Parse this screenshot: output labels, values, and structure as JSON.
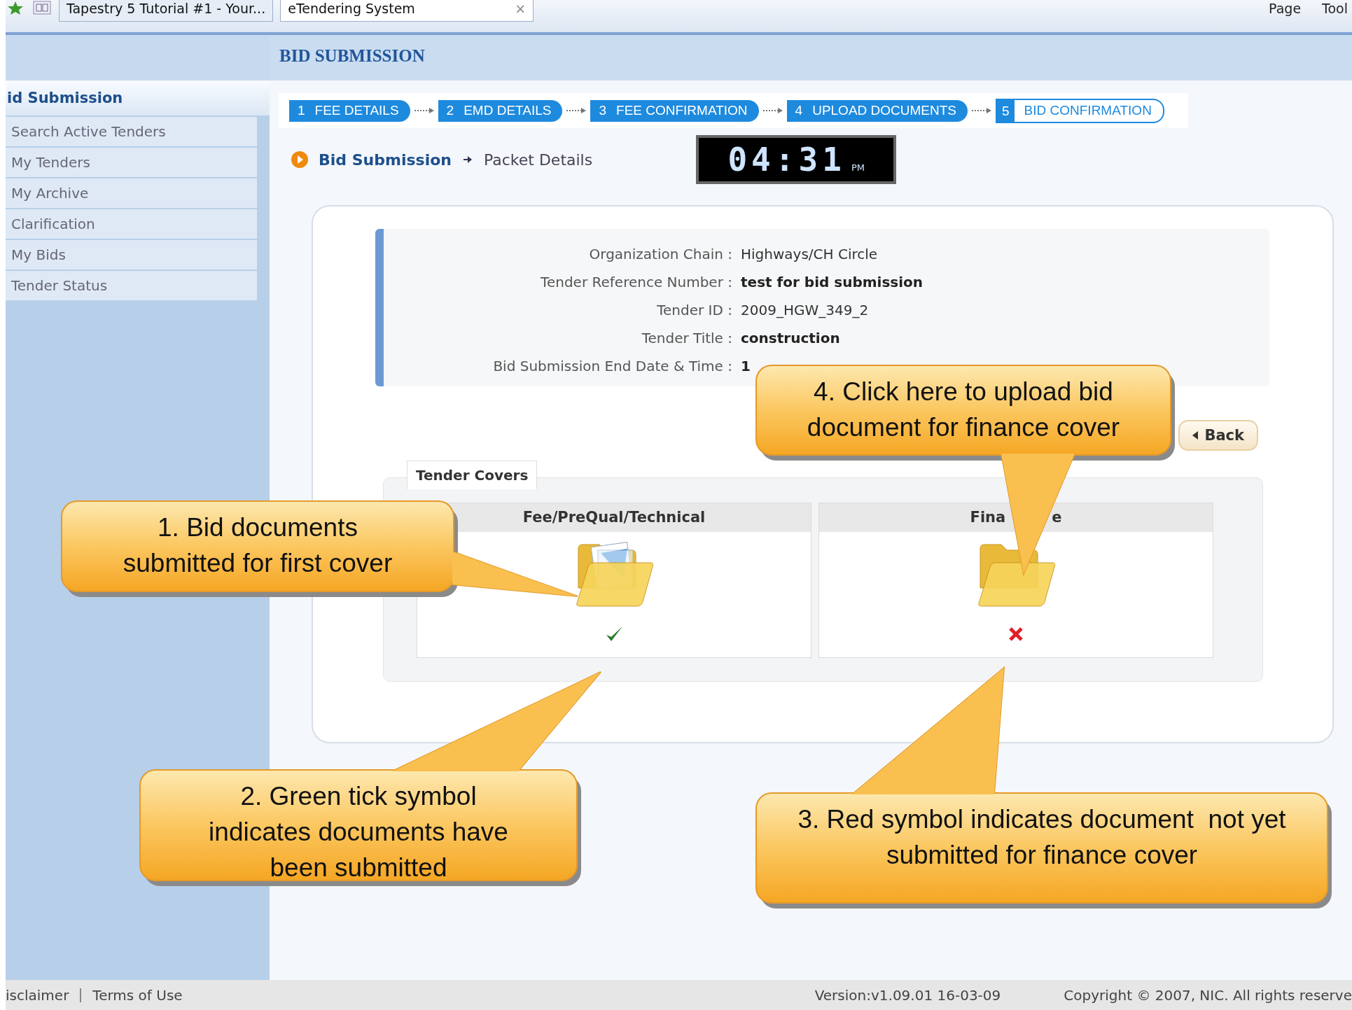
{
  "browser": {
    "tabs": [
      {
        "title": "Tapestry 5 Tutorial #1 - Your...",
        "selected": false
      },
      {
        "title": "eTendering System",
        "selected": true,
        "close": "×"
      }
    ],
    "tools": [
      "Page",
      "Tool"
    ]
  },
  "sidebar": {
    "title": "id Submission",
    "items": [
      "Search Active Tenders",
      "My Tenders",
      "My Archive",
      "Clarification",
      "My Bids",
      "Tender Status"
    ]
  },
  "page_title": "BID SUBMISSION",
  "steps": [
    {
      "number": "1",
      "label": "FEE DETAILS",
      "selected": false
    },
    {
      "number": "2",
      "label": "EMD DETAILS",
      "selected": false
    },
    {
      "number": "3",
      "label": "FEE CONFIRMATION",
      "selected": false
    },
    {
      "number": "4",
      "label": "UPLOAD DOCUMENTS",
      "selected": false
    },
    {
      "number": "5",
      "label": "BID CONFIRMATION",
      "selected": true
    }
  ],
  "breadcrumb": [
    "Bid Submission",
    "Packet Details"
  ],
  "clock": {
    "time": "04:31",
    "period": "PM"
  },
  "details": [
    {
      "label": "Organization Chain :",
      "value": "Highways/CH Circle",
      "bold": false
    },
    {
      "label": "Tender Reference Number :",
      "value": "test for bid submission",
      "bold": true
    },
    {
      "label": "Tender ID :",
      "value": "2009_HGW_349_2",
      "bold": false
    },
    {
      "label": "Tender Title :",
      "value": "construction",
      "bold": true
    },
    {
      "label": "Bid Submission End Date & Time :",
      "value": "1",
      "bold": true
    }
  ],
  "back_button": "Back",
  "covers": {
    "title": "Tender Covers",
    "columns": [
      {
        "name_parts": [
          "Fee/PreQual/Technical"
        ],
        "has_documents": true,
        "submitted": true
      },
      {
        "name_parts": [
          "Fina",
          "e"
        ],
        "has_documents": false,
        "submitted": false
      }
    ]
  },
  "callouts": [
    {
      "text": "4. Click here to upload bid document for finance cover"
    },
    {
      "text": "1. Bid documents submitted for first cover"
    },
    {
      "text": "2. Green tick symbol indicates documents have been submitted"
    },
    {
      "text": "3. Red symbol indicates document  not yet  submitted for finance cover"
    }
  ],
  "footer": {
    "links": [
      "isclaimer",
      "Terms of Use"
    ],
    "version": "Version:v1.09.01 16-03-09",
    "copyright": "Copyright © 2007, NIC. All rights reserve"
  }
}
